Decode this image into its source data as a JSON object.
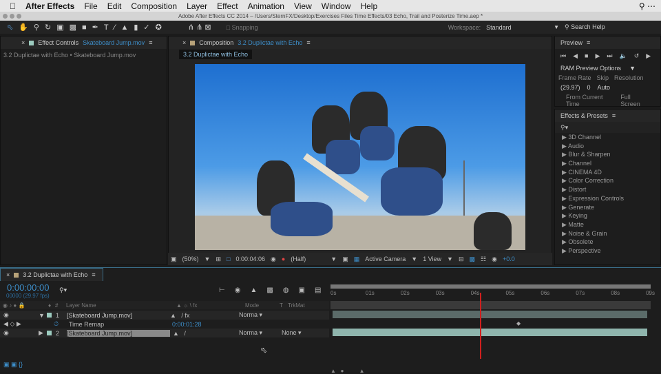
{
  "menubar": {
    "app": "After Effects",
    "items": [
      "File",
      "Edit",
      "Composition",
      "Layer",
      "Effect",
      "Animation",
      "View",
      "Window",
      "Help"
    ]
  },
  "window_title": "Adobe After Effects CC 2014 – /Users/SternFX/Desktop/Exercises Files Time Effects/03 Echo, Trail and Posterize Time.aep *",
  "toolbar": {
    "snapping": "Snapping",
    "workspace_label": "Workspace:",
    "workspace_value": "Standard",
    "search_placeholder": "Search Help"
  },
  "effect_controls": {
    "tab_label": "Effect Controls",
    "tab_layer": "Skateboard Jump.mov",
    "breadcrumb": "3.2 Duplictae with Echo • Skateboard Jump.mov"
  },
  "composition": {
    "tab_label": "Composition",
    "tab_name": "3.2 Duplictae with Echo",
    "comp_chip": "3.2 Duplictae with Echo",
    "bar": {
      "zoom": "(50%)",
      "timecode": "0:00:04:06",
      "resolution": "(Half)",
      "camera": "Active Camera",
      "views": "1 View",
      "exposure": "+0.0"
    }
  },
  "preview": {
    "title": "Preview",
    "ram_options": "RAM Preview Options",
    "frame_rate_label": "Frame Rate",
    "skip_label": "Skip",
    "resolution_label": "Resolution",
    "frame_rate": "(29.97)",
    "skip": "0",
    "resolution": "Auto",
    "from_current": "From Current Time",
    "full_screen": "Full Screen"
  },
  "effects_presets": {
    "title": "Effects & Presets",
    "items": [
      "3D Channel",
      "Audio",
      "Blur & Sharpen",
      "Channel",
      "CINEMA 4D",
      "Color Correction",
      "Distort",
      "Expression Controls",
      "Generate",
      "Keying",
      "Matte",
      "Noise & Grain",
      "Obsolete",
      "Perspective"
    ]
  },
  "timeline": {
    "tab": "3.2 Duplictae with Echo",
    "timecode": "0:00:00:00",
    "frames": "00000 (29.97 fps)",
    "headers": {
      "num": "#",
      "layer_name": "Layer Name",
      "mode": "Mode",
      "t": "T",
      "trkmat": "TrkMat"
    },
    "layers": [
      {
        "num": "1",
        "name": "[Skateboard Jump.mov]",
        "mode": "Norma"
      },
      {
        "num": "2",
        "name": "[Skateboard Jump.mov]",
        "mode": "Norma",
        "trkmat": "None"
      }
    ],
    "property": {
      "name": "Time Remap",
      "value": "0:00:01:28"
    },
    "ruler": [
      "0s",
      "01s",
      "02s",
      "03s",
      "04s",
      "05s",
      "06s",
      "07s",
      "08s",
      "09s"
    ],
    "playhead_seconds": 4.2
  }
}
